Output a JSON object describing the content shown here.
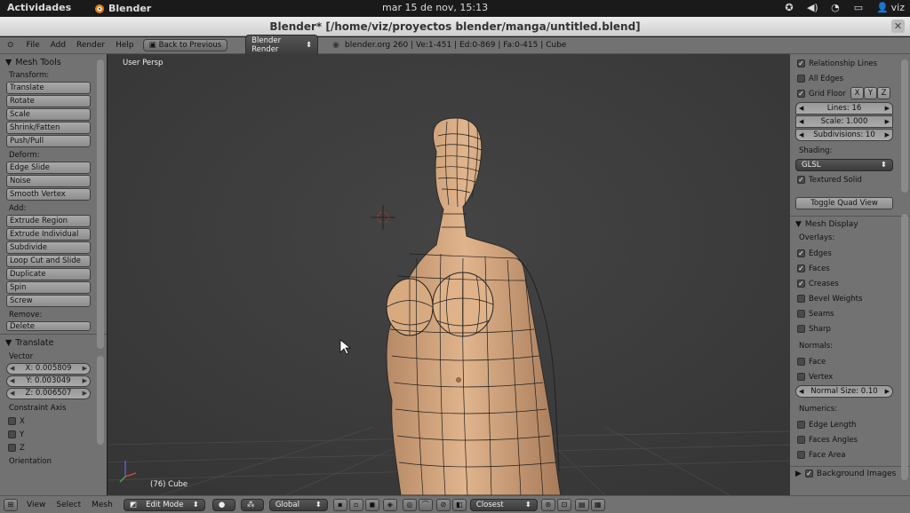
{
  "gnome": {
    "activities": "Actividades",
    "app_name": "Blender",
    "clock": "mar 15 de nov, 15:13",
    "user": "viz"
  },
  "window": {
    "title": "Blender* [/home/viz/proyectos blender/manga/untitled.blend]"
  },
  "header": {
    "menus": [
      "File",
      "Add",
      "Render",
      "Help"
    ],
    "back_button": "Back to Previous",
    "engine": "Blender Render",
    "stats": "blender.org 260 | Ve:1-451 | Ed:0-869 | Fa:0-415 | Cube"
  },
  "left_panel": {
    "mesh_tools_title": "Mesh Tools",
    "transform_label": "Transform:",
    "transform_buttons": [
      "Translate",
      "Rotate",
      "Scale",
      "Shrink/Fatten",
      "Push/Pull"
    ],
    "deform_label": "Deform:",
    "deform_buttons": [
      "Edge Slide",
      "Noise",
      "Smooth Vertex"
    ],
    "add_label": "Add:",
    "add_buttons": [
      "Extrude Region",
      "Extrude Individual",
      "Subdivide",
      "Loop Cut and Slide",
      "Duplicate",
      "Spin",
      "Screw"
    ],
    "remove_label": "Remove:",
    "remove_buttons": [
      "Delete"
    ],
    "translate_title": "Translate",
    "vector_label": "Vector",
    "vector": [
      "X: 0.005809",
      "Y: 0.003049",
      "Z: 0.006507"
    ],
    "constraint_label": "Constraint Axis",
    "constraint_axes": [
      "X",
      "Y",
      "Z"
    ],
    "orientation_label": "Orientation"
  },
  "viewport": {
    "view_label": "User Persp",
    "object_label": "(76) Cube"
  },
  "right_panel": {
    "relationship_lines": "Relationship Lines",
    "all_edges": "All Edges",
    "grid_floor": "Grid Floor",
    "axes": [
      "X",
      "Y",
      "Z"
    ],
    "lines": "Lines: 16",
    "scale": "Scale: 1.000",
    "subdivisions": "Subdivisions: 10",
    "shading_label": "Shading:",
    "shading_value": "GLSL",
    "textured_solid": "Textured Solid",
    "toggle_quad": "Toggle Quad View",
    "mesh_display_title": "Mesh Display",
    "overlays_label": "Overlays:",
    "overlays": [
      {
        "label": "Edges",
        "checked": true
      },
      {
        "label": "Faces",
        "checked": true
      },
      {
        "label": "Creases",
        "checked": true
      },
      {
        "label": "Bevel Weights",
        "checked": false
      },
      {
        "label": "Seams",
        "checked": false
      },
      {
        "label": "Sharp",
        "checked": false
      }
    ],
    "normals_label": "Normals:",
    "normals": [
      {
        "label": "Face",
        "checked": false
      },
      {
        "label": "Vertex",
        "checked": false
      }
    ],
    "normal_size": "Normal Size: 0.10",
    "numerics_label": "Numerics:",
    "numerics": [
      {
        "label": "Edge Length",
        "checked": false
      },
      {
        "label": "Faces Angles",
        "checked": false
      },
      {
        "label": "Face Area",
        "checked": false
      }
    ],
    "background_images": "Background Images"
  },
  "footer": {
    "menus": [
      "View",
      "Select",
      "Mesh"
    ],
    "mode": "Edit Mode",
    "orientation": "Global",
    "snap": "Closest"
  },
  "colors": {
    "panel_bg": "#727272",
    "viewport_bg": "#3d3d3d",
    "skin": "#d9aa82",
    "wire": "#1a1a1a"
  }
}
